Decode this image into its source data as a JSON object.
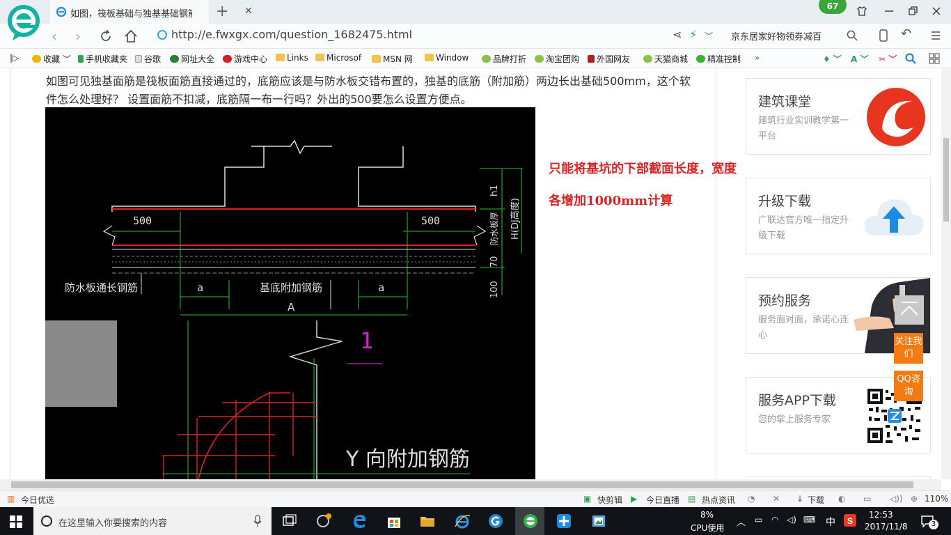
{
  "browser": {
    "tab_title": "如图，筏板基础与独基基础钢筋长",
    "tab_close": "✕",
    "new_tab": "+",
    "badge_count": "67",
    "url": "http://e.fwxgx.com/question_1682475.html",
    "search_hint": "京东居家好物领券减百"
  },
  "bookmarks": [
    {
      "label": "收藏",
      "icon": "star-icon"
    },
    {
      "label": "手机收藏夹",
      "icon": "phone-icon"
    },
    {
      "label": "谷歌",
      "icon": "page-icon"
    },
    {
      "label": "网址大全",
      "icon": "web-icon"
    },
    {
      "label": "游戏中心",
      "icon": "game-icon"
    },
    {
      "label": "Links",
      "icon": "folder-icon"
    },
    {
      "label": "Microsof",
      "icon": "folder-icon"
    },
    {
      "label": "MSN 网",
      "icon": "folder-icon"
    },
    {
      "label": "Window",
      "icon": "folder-icon"
    },
    {
      "label": "品牌打折",
      "icon": "leaf-icon"
    },
    {
      "label": "淘宝团购",
      "icon": "leaf-icon"
    },
    {
      "label": "外国网友",
      "icon": "red-icon"
    },
    {
      "label": "天猫商城",
      "icon": "leaf-icon"
    },
    {
      "label": "精准控制",
      "icon": "wechat-icon"
    }
  ],
  "question": {
    "text": "如图可见独基面筋是筏板面筋直接通过的，底筋应该是与防水板交错布置的，独基的底筋（附加筋）两边长出基础500mm，这个软件怎么处理好？  设置面筋不扣减，底筋隔一布一行吗？外出的500要怎么设置方便点。"
  },
  "cad": {
    "dim_500_left": "500",
    "dim_500_right": "500",
    "label_waterproof_rebar": "防水板通长钢筋",
    "label_base_rebar": "基底附加钢筋",
    "label_a_left": "a",
    "label_a_right": "a",
    "label_A": "A",
    "label_h1": "h1",
    "label_hdj": "H(DJ高度)",
    "label_slab_thk": "防水板厚",
    "label_70": "70",
    "label_100": "100",
    "label_1": "1",
    "label_y_rebar": "Y 向附加钢筋"
  },
  "notes": {
    "line1": "只能将基坑的下部截面长度，宽度",
    "line2": "各增加1000mm计算"
  },
  "sidebar": [
    {
      "title": "建筑课堂",
      "subtitle": "建筑行业实训教学第一平台"
    },
    {
      "title": "升级下载",
      "subtitle": "广联达官方唯一指定升级下载"
    },
    {
      "title": "预约服务",
      "subtitle": "服务面对面，承诺心连心"
    },
    {
      "title": "服务APP下载",
      "subtitle": "您的掌上服务专家"
    }
  ],
  "float_buttons": {
    "follow": "关注我们",
    "qq": "QQ咨询"
  },
  "statusbar": {
    "left": "今日优选",
    "items": [
      "快剪辑",
      "今日直播",
      "热点资讯",
      "下载"
    ],
    "zoom": "110%"
  },
  "taskbar": {
    "search_placeholder": "在这里输入你要搜索的内容",
    "cpu_pct": "8%",
    "cpu_label": "CPU使用",
    "ime": "中",
    "time": "12:53",
    "date": "2017/11/8",
    "notif_count": "3"
  }
}
